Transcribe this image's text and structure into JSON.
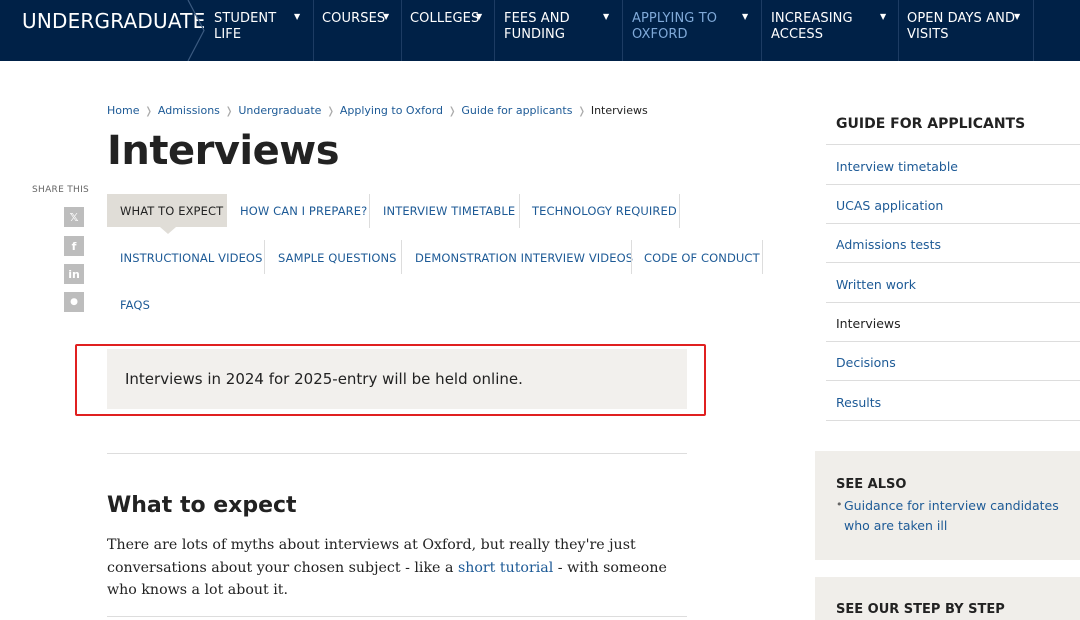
{
  "nav": {
    "brand": "UNDERGRADUATE",
    "items": [
      {
        "line1": "STUDENT",
        "line2": "LIFE",
        "active": false
      },
      {
        "line1": "COURSES",
        "line2": "",
        "active": false
      },
      {
        "line1": "COLLEGES",
        "line2": "",
        "active": false
      },
      {
        "line1": "FEES AND",
        "line2": "FUNDING",
        "active": false
      },
      {
        "line1": "APPLYING TO",
        "line2": "OXFORD",
        "active": true
      },
      {
        "line1": "INCREASING",
        "line2": "ACCESS",
        "active": false
      },
      {
        "line1": "OPEN DAYS AND",
        "line2": "VISITS",
        "active": false
      }
    ],
    "caret": "▼"
  },
  "breadcrumb": [
    "Home",
    "Admissions",
    "Undergraduate",
    "Applying to Oxford",
    "Guide for applicants",
    "Interviews"
  ],
  "breadcrumb_sep": "❭",
  "page_title": "Interviews",
  "share": {
    "label": "SHARE THIS",
    "icons": [
      "x-icon",
      "facebook-icon",
      "linkedin-icon",
      "reddit-icon"
    ],
    "glyphs": [
      "𝕏",
      "f",
      "in",
      "●"
    ]
  },
  "tabs": [
    "WHAT TO EXPECT",
    "HOW CAN I PREPARE?",
    "INTERVIEW TIMETABLE",
    "TECHNOLOGY REQUIRED",
    "INSTRUCTIONAL VIDEOS",
    "SAMPLE QUESTIONS",
    "DEMONSTRATION INTERVIEW VIDEOS",
    "CODE OF CONDUCT",
    "FAQS"
  ],
  "active_tab": "WHAT TO EXPECT",
  "notice": "Interviews in 2024 for 2025-entry will be held online.",
  "section": {
    "heading": "What to expect",
    "text_before": "There are lots of myths about interviews at Oxford, but really they're just conversations about your chosen subject - like a ",
    "link": "short tutorial",
    "text_after": " - with someone who knows a lot about it."
  },
  "sidebar": {
    "title": "GUIDE FOR APPLICANTS",
    "items": [
      "Interview timetable",
      "UCAS application",
      "Admissions tests",
      "Written work",
      "Interviews",
      "Decisions",
      "Results"
    ],
    "current": "Interviews"
  },
  "see_also": {
    "title": "SEE ALSO",
    "bullet": "•",
    "link": "Guidance for interview candidates who are taken ill"
  },
  "step_by_step": {
    "title": "SEE OUR STEP BY STEP"
  },
  "colors": {
    "nav_bg": "#002147",
    "link": "#1d5a96",
    "highlight": "#e02020"
  }
}
